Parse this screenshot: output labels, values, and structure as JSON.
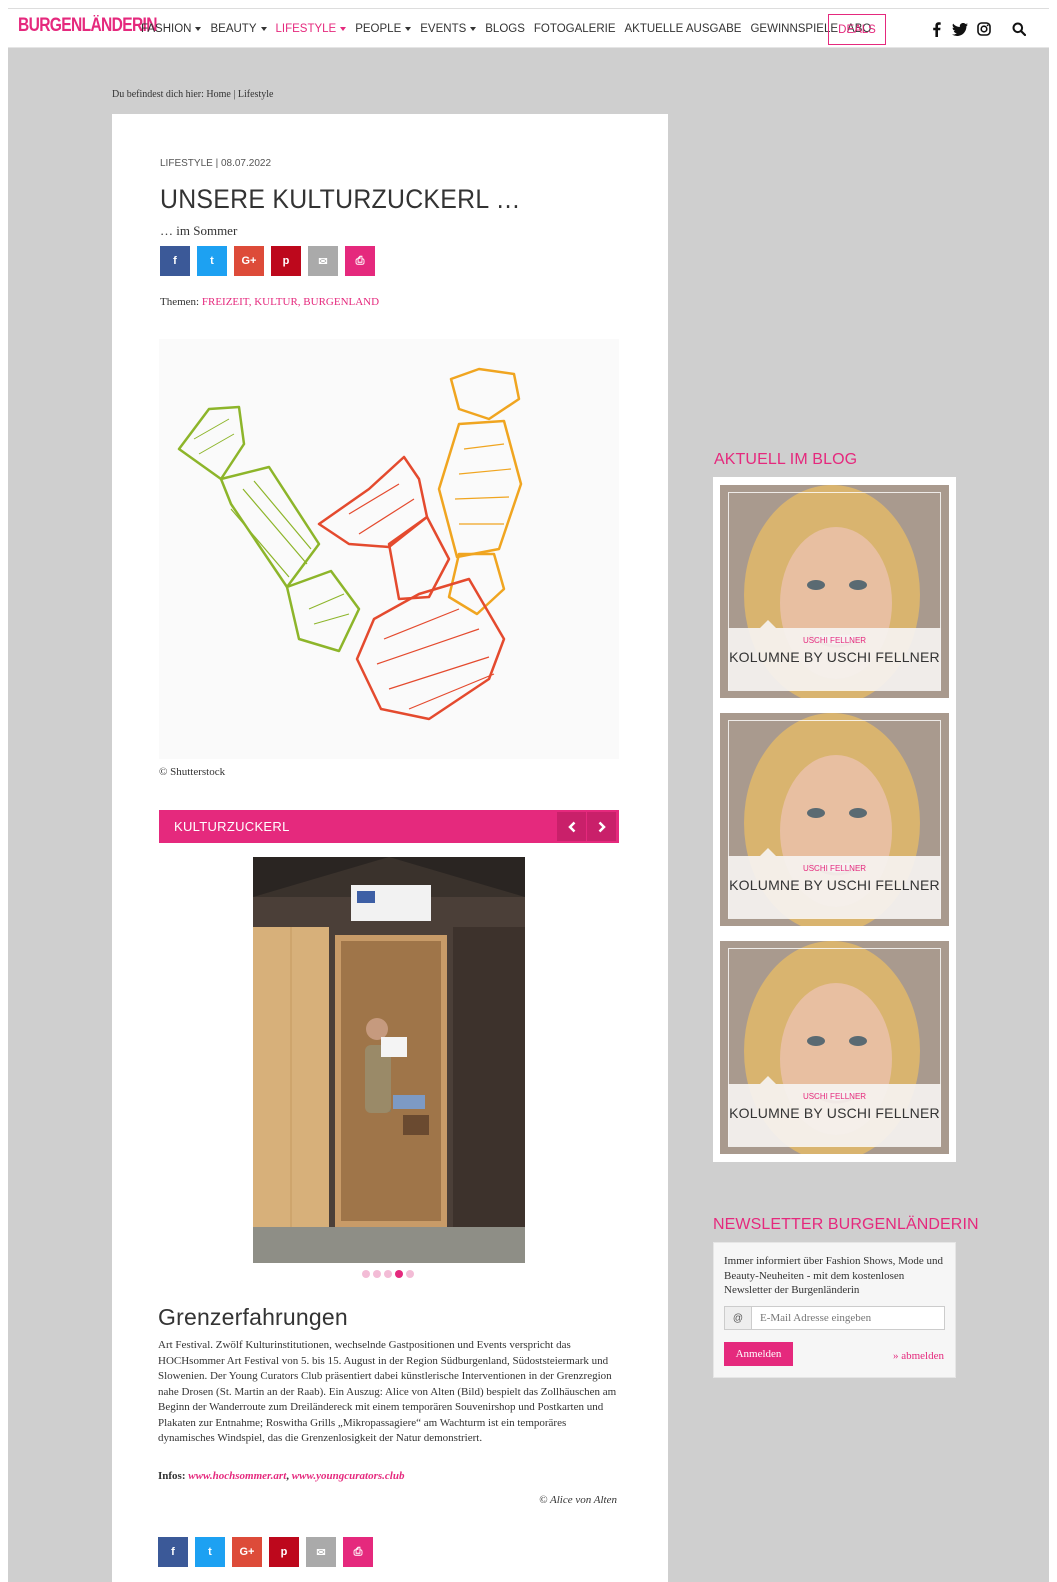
{
  "brand": {
    "logo": "BURGENLÄNDERIN",
    "accent": "#e5297d"
  },
  "nav": {
    "items": [
      {
        "label": "FASHION",
        "dropdown": true,
        "active": false
      },
      {
        "label": "BEAUTY",
        "dropdown": true,
        "active": false
      },
      {
        "label": "LIFESTYLE",
        "dropdown": true,
        "active": true
      },
      {
        "label": "PEOPLE",
        "dropdown": true,
        "active": false
      },
      {
        "label": "EVENTS",
        "dropdown": true,
        "active": false
      },
      {
        "label": "BLOGS",
        "dropdown": false,
        "active": false
      },
      {
        "label": "FOTOGALERIE",
        "dropdown": false,
        "active": false
      },
      {
        "label": "AKTUELLE AUSGABE",
        "dropdown": false,
        "active": false
      },
      {
        "label": "GEWINNSPIELE",
        "dropdown": false,
        "active": false
      },
      {
        "label": "ABO",
        "dropdown": false,
        "active": false
      }
    ],
    "deals": "DEALS",
    "social_icons": [
      "facebook-icon",
      "twitter-icon",
      "instagram-icon"
    ],
    "search_icon": "search-icon"
  },
  "breadcrumb": {
    "prefix": "Du befindest dich hier:",
    "home": "Home",
    "separator": "|",
    "current": "Lifestyle"
  },
  "article": {
    "meta": "LIFESTYLE | 08.07.2022",
    "title": "UNSERE KULTURZUCKERL …",
    "subtitle": "… im Sommer",
    "share_buttons": [
      {
        "name": "facebook",
        "glyph": "f",
        "color": "#3b5998"
      },
      {
        "name": "twitter",
        "glyph": "t",
        "color": "#1da1f2"
      },
      {
        "name": "google-plus",
        "glyph": "G+",
        "color": "#dd4b39"
      },
      {
        "name": "pinterest",
        "glyph": "p",
        "color": "#bd081c"
      },
      {
        "name": "email",
        "glyph": "✉",
        "color": "#aaaaaa"
      },
      {
        "name": "print",
        "glyph": "⎙",
        "color": "#e5297d"
      }
    ],
    "themes_label": "Themen:",
    "themes": "FREIZEIT, KULTUR, BURGENLAND",
    "hero_credit": "© Shutterstock",
    "gallery": {
      "title": "KULTURZUCKERL",
      "dots": 5,
      "active_dot": 4
    },
    "section_title": "Grenzerfahrungen",
    "body": "Art Festival. Zwölf Kulturinstitutionen, wechselnde Gastpositionen und Events verspricht das HOCHsommer Art Festival von 5. bis 15. August in der Region Südburgenland, Südoststeiermark und Slowenien. Der Young Curators Club präsentiert dabei künstlerische Interventionen in der Grenzregion nahe Drosen (St. Martin an der Raab). Ein Auszug: Alice von Alten (Bild) bespielt das Zollhäuschen am Beginn der Wanderroute zum Dreiländereck mit einem temporären Souvenirshop und Postkarten und Plakaten zur Entnahme; Roswitha Grills „Mikropassagiere“ am Wachturm ist ein temporäres dynamisches Windspiel, das die Grenzen­losigkeit der Natur demonstriert.",
    "infos_label": "Infos:",
    "infos_link1": "www.hochsommer.art",
    "infos_sep": ",",
    "infos_link2": "www.youngcurators.club",
    "photo_credit": "© Alice von Alten"
  },
  "sidebar": {
    "blog_heading": "AKTUELL IM BLOG",
    "blog_cards": [
      {
        "author": "USCHI FELLNER",
        "title": "KOLUMNE BY USCHI FELLNER"
      },
      {
        "author": "USCHI FELLNER",
        "title": "KOLUMNE BY USCHI FELLNER"
      },
      {
        "author": "USCHI FELLNER",
        "title": "KOLUMNE BY USCHI FELLNER"
      }
    ],
    "newsletter_heading": "NEWSLETTER BURGENLÄNDERIN",
    "newsletter_text": "Immer informiert über Fashion Shows, Mode und Beauty-Neuheiten - mit dem kostenlosen Newsletter der Burgenländerin",
    "newsletter_at": "@",
    "newsletter_placeholder": "E-Mail Adresse eingeben",
    "newsletter_submit": "Anmelden",
    "newsletter_unsubscribe": "» abmelden"
  }
}
